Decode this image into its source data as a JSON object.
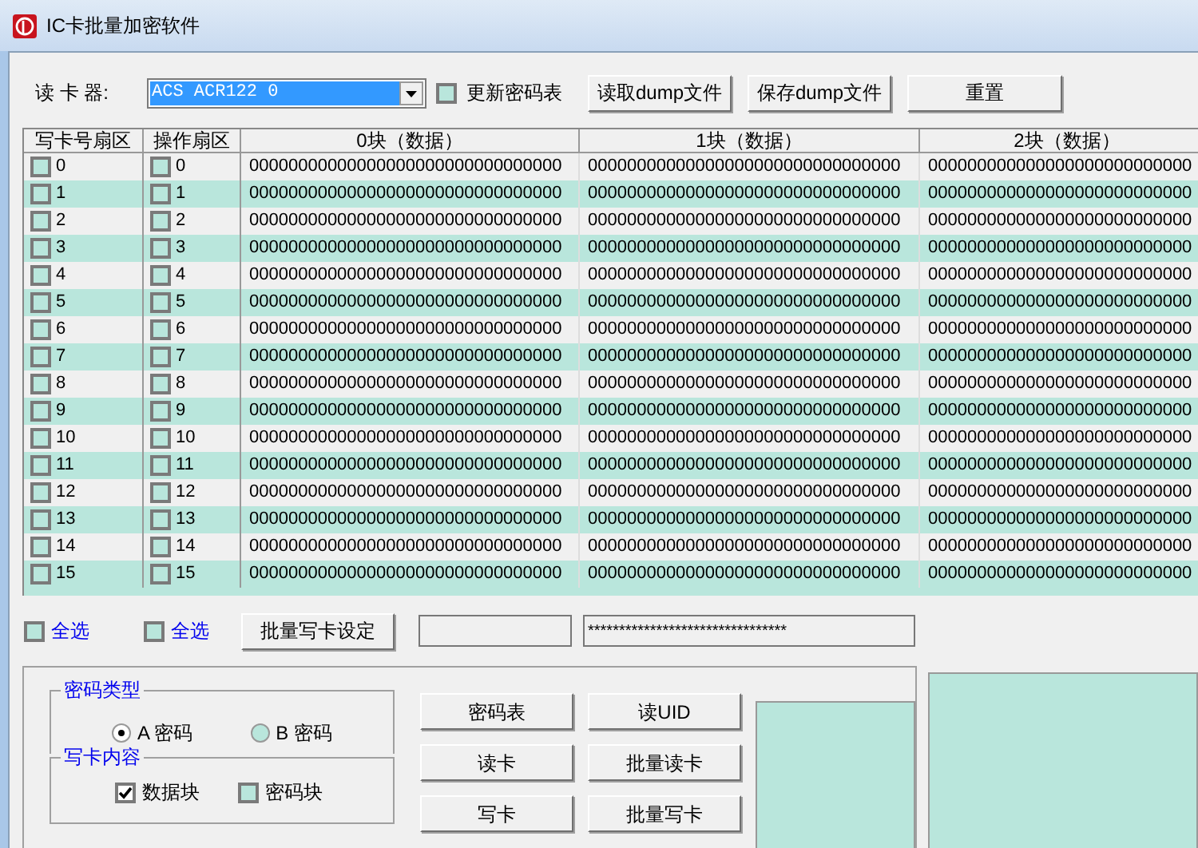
{
  "window": {
    "title": "IC卡批量加密软件"
  },
  "toolbar": {
    "reader_label": "读 卡 器:",
    "reader_value": "ACS ACR122 0",
    "update_keys": {
      "label": "更新密码表",
      "checked": false
    },
    "buttons": [
      "读取dump文件",
      "保存dump文件",
      "重置"
    ]
  },
  "table": {
    "columns": [
      "写卡号扇区",
      "操作扇区",
      "0块（数据）",
      "1块（数据）",
      "2块（数据）"
    ],
    "rows": [
      {
        "checks": [
          false,
          false
        ],
        "cells": [
          "0",
          "0",
          "00000000000000000000000000000000",
          "00000000000000000000000000000000",
          "000000000000000000000000000"
        ]
      },
      {
        "checks": [
          false,
          false
        ],
        "cells": [
          "1",
          "1",
          "00000000000000000000000000000000",
          "00000000000000000000000000000000",
          "000000000000000000000000000"
        ]
      },
      {
        "checks": [
          false,
          false
        ],
        "cells": [
          "2",
          "2",
          "00000000000000000000000000000000",
          "00000000000000000000000000000000",
          "000000000000000000000000000"
        ]
      },
      {
        "checks": [
          false,
          false
        ],
        "cells": [
          "3",
          "3",
          "00000000000000000000000000000000",
          "00000000000000000000000000000000",
          "000000000000000000000000000"
        ]
      },
      {
        "checks": [
          false,
          false
        ],
        "cells": [
          "4",
          "4",
          "00000000000000000000000000000000",
          "00000000000000000000000000000000",
          "000000000000000000000000000"
        ]
      },
      {
        "checks": [
          false,
          false
        ],
        "cells": [
          "5",
          "5",
          "00000000000000000000000000000000",
          "00000000000000000000000000000000",
          "000000000000000000000000000"
        ]
      },
      {
        "checks": [
          false,
          false
        ],
        "cells": [
          "6",
          "6",
          "00000000000000000000000000000000",
          "00000000000000000000000000000000",
          "000000000000000000000000000"
        ]
      },
      {
        "checks": [
          false,
          false
        ],
        "cells": [
          "7",
          "7",
          "00000000000000000000000000000000",
          "00000000000000000000000000000000",
          "000000000000000000000000000"
        ]
      },
      {
        "checks": [
          false,
          false
        ],
        "cells": [
          "8",
          "8",
          "00000000000000000000000000000000",
          "00000000000000000000000000000000",
          "000000000000000000000000000"
        ]
      },
      {
        "checks": [
          false,
          false
        ],
        "cells": [
          "9",
          "9",
          "00000000000000000000000000000000",
          "00000000000000000000000000000000",
          "000000000000000000000000000"
        ]
      },
      {
        "checks": [
          false,
          false
        ],
        "cells": [
          "10",
          "10",
          "00000000000000000000000000000000",
          "00000000000000000000000000000000",
          "000000000000000000000000000"
        ]
      },
      {
        "checks": [
          false,
          false
        ],
        "cells": [
          "11",
          "11",
          "00000000000000000000000000000000",
          "00000000000000000000000000000000",
          "000000000000000000000000000"
        ]
      },
      {
        "checks": [
          false,
          false
        ],
        "cells": [
          "12",
          "12",
          "00000000000000000000000000000000",
          "00000000000000000000000000000000",
          "000000000000000000000000000"
        ]
      },
      {
        "checks": [
          false,
          false
        ],
        "cells": [
          "13",
          "13",
          "00000000000000000000000000000000",
          "00000000000000000000000000000000",
          "000000000000000000000000000"
        ]
      },
      {
        "checks": [
          false,
          false
        ],
        "cells": [
          "14",
          "14",
          "00000000000000000000000000000000",
          "00000000000000000000000000000000",
          "000000000000000000000000000"
        ]
      },
      {
        "checks": [
          false,
          false
        ],
        "cells": [
          "15",
          "15",
          "00000000000000000000000000000000",
          "00000000000000000000000000000000",
          "000000000000000000000000000"
        ]
      }
    ]
  },
  "select_row": {
    "select_all": [
      {
        "label": "全选",
        "checked": false
      },
      {
        "label": "全选",
        "checked": false
      }
    ],
    "batch_button": "批量写卡设定",
    "key_value": "********************************"
  },
  "key_type": {
    "title": "密码类型",
    "options": [
      {
        "label": "A 密码",
        "selected": true
      },
      {
        "label": "B 密码",
        "selected": false
      }
    ]
  },
  "write_content": {
    "title": "写卡内容",
    "options": [
      {
        "label": "数据块",
        "checked": true
      },
      {
        "label": "密码块",
        "checked": false
      }
    ]
  },
  "buttons": [
    [
      "密码表",
      "读卡",
      "写卡"
    ],
    [
      "读UID",
      "批量读卡",
      "批量写卡"
    ]
  ]
}
